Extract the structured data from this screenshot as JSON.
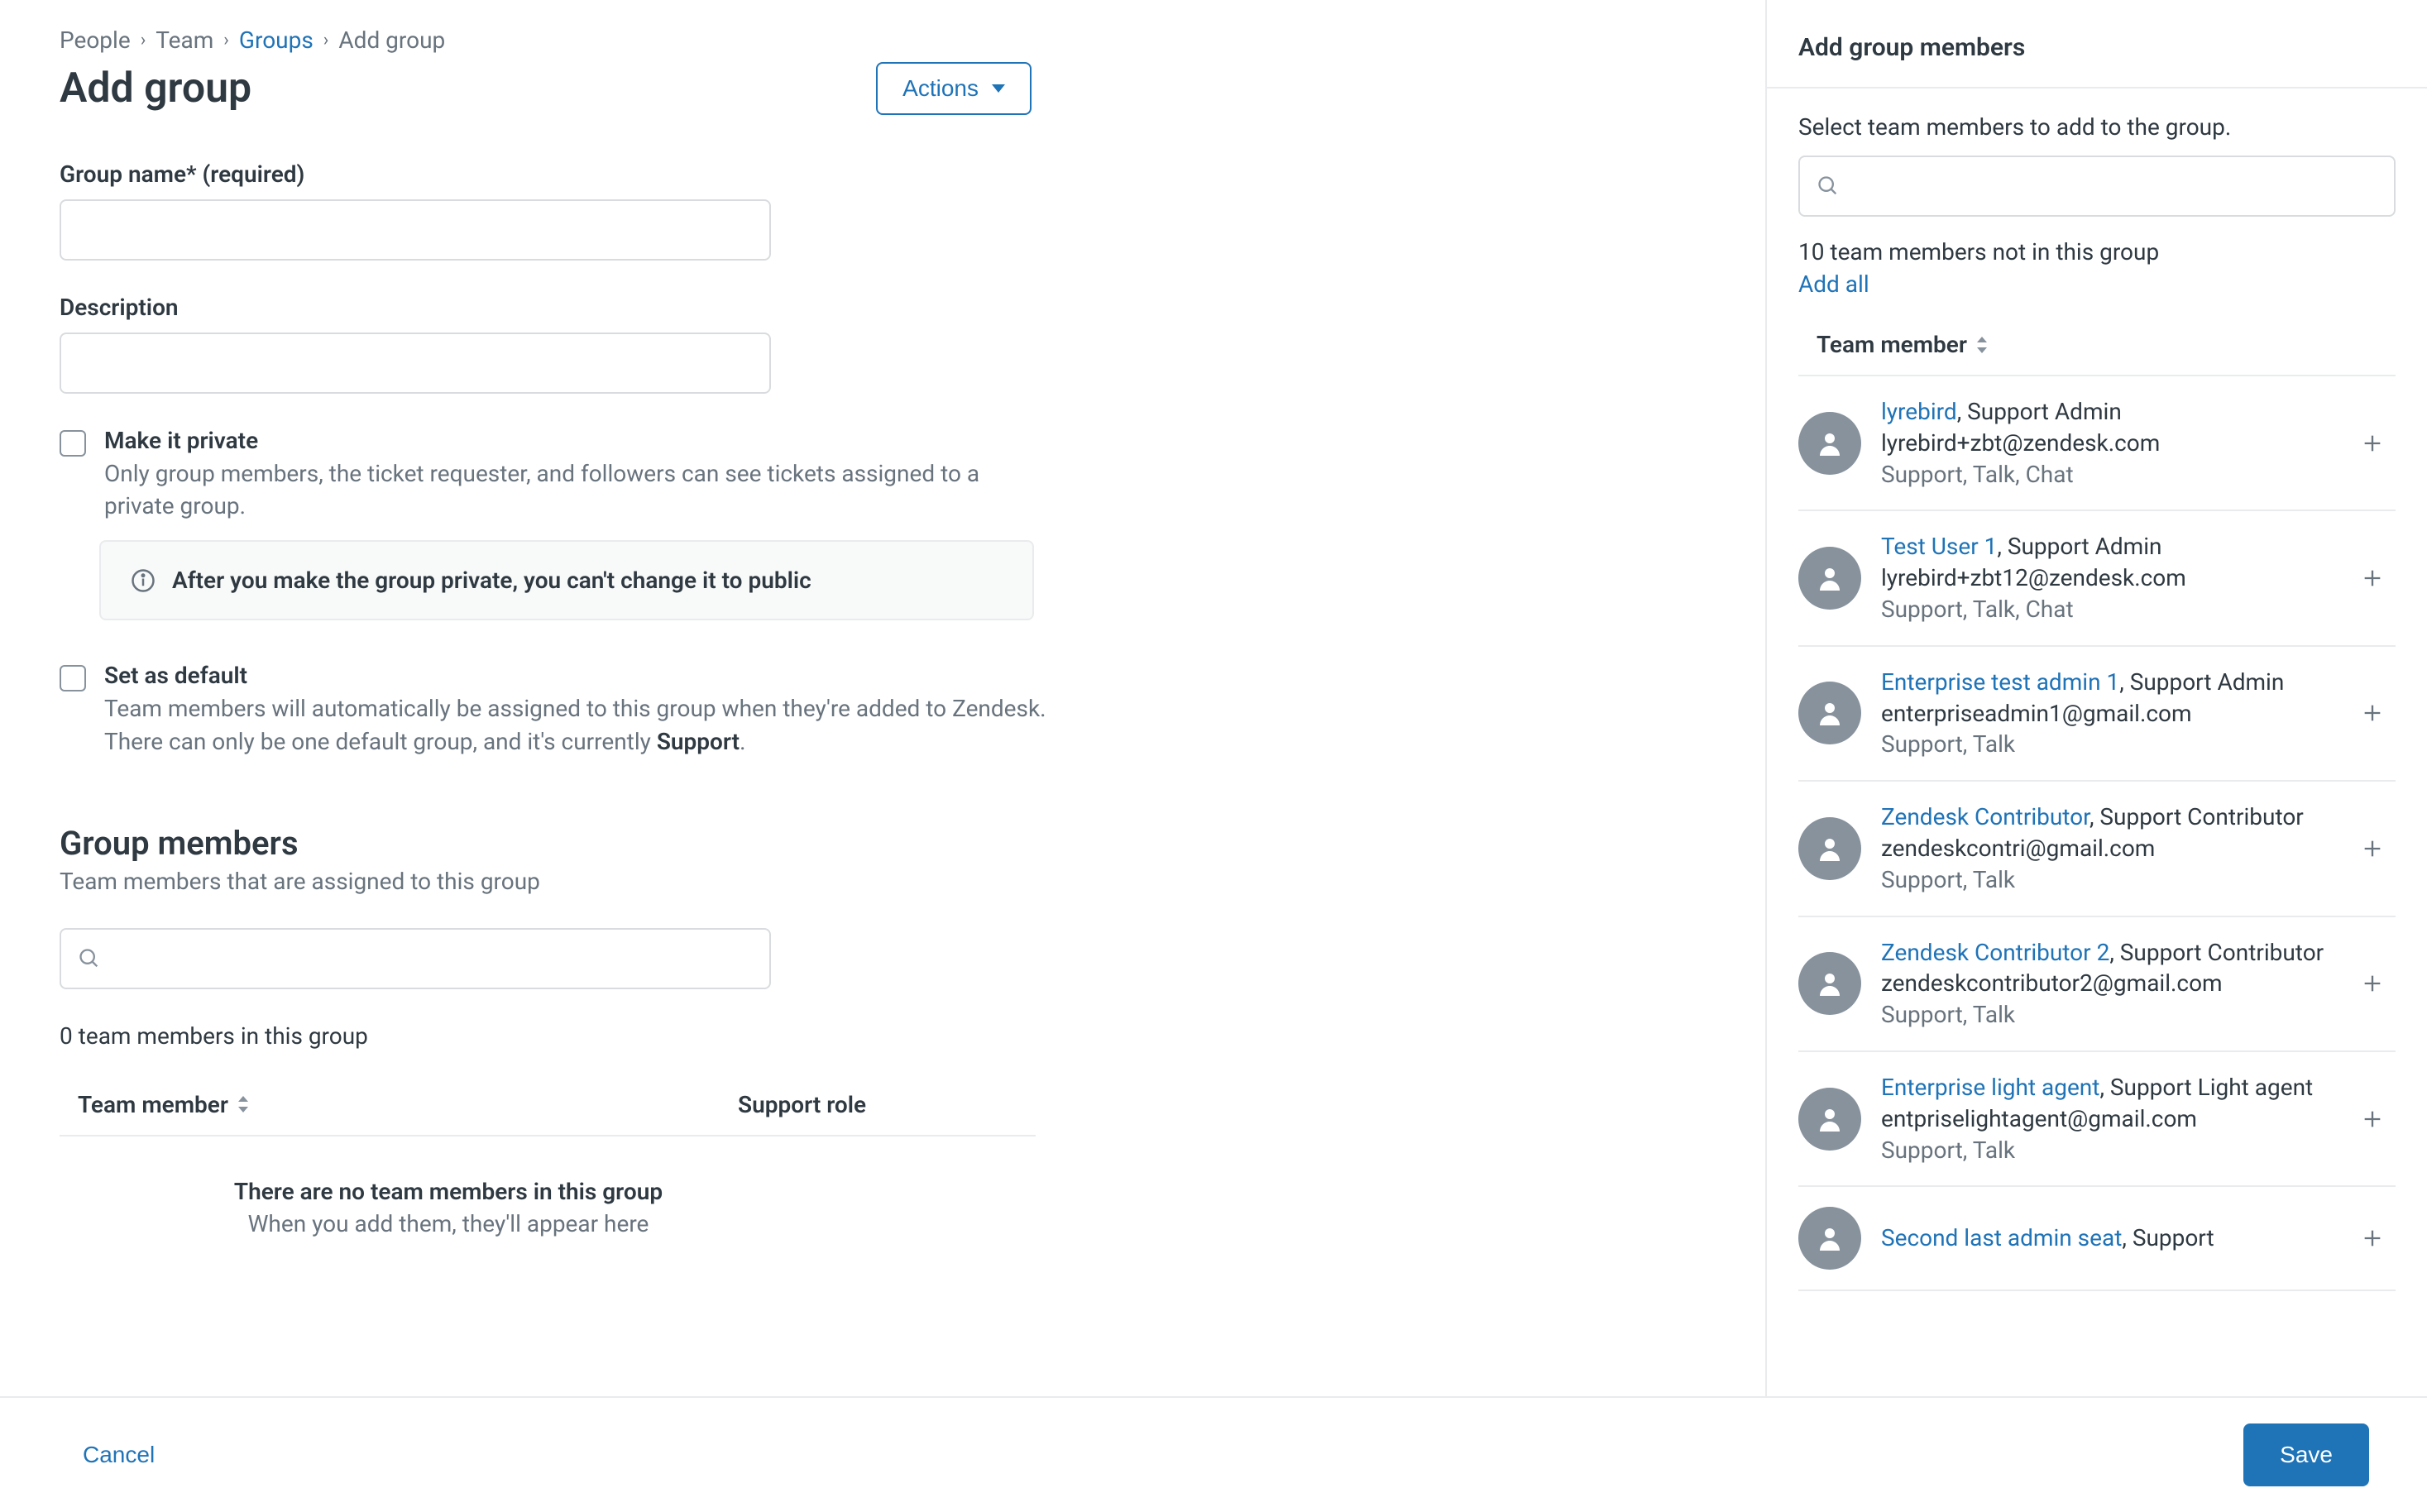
{
  "breadcrumb": {
    "people": "People",
    "team": "Team",
    "groups": "Groups",
    "current": "Add group"
  },
  "page_title": "Add group",
  "actions_label": "Actions",
  "form": {
    "group_name_label": "Group name* (required)",
    "description_label": "Description",
    "private": {
      "title": "Make it private",
      "desc": "Only group members, the ticket requester, and followers can see tickets assigned to a private group.",
      "info": "After you make the group private, you can't change it to public"
    },
    "default": {
      "title": "Set as default",
      "desc_before": "Team members will automatically be assigned to this group when they're added to Zendesk. There can only be one default group, and it's currently ",
      "desc_strong": "Support",
      "desc_after": "."
    }
  },
  "members_section": {
    "heading": "Group members",
    "sub": "Team members that are assigned to this group",
    "count_line": "0 team members in this group",
    "col_member": "Team member",
    "col_role": "Support role",
    "empty_line1": "There are no team members in this group",
    "empty_line2": "When you add them, they'll appear here"
  },
  "side": {
    "heading": "Add group members",
    "hint": "Select team members to add to the group.",
    "count_line": "10 team members not in this group",
    "add_all": "Add all",
    "col_member": "Team member",
    "members": [
      {
        "name": "lyrebird",
        "role": "Support Admin",
        "email": "lyrebird+zbt@zendesk.com",
        "products": "Support, Talk, Chat"
      },
      {
        "name": "Test User 1",
        "role": "Support Admin",
        "email": "lyrebird+zbt12@zendesk.com",
        "products": "Support, Talk, Chat"
      },
      {
        "name": "Enterprise test admin 1",
        "role": "Support Admin",
        "email": "enterpriseadmin1@gmail.com",
        "products": "Support, Talk"
      },
      {
        "name": "Zendesk Contributor",
        "role": "Support Contributor",
        "email": "zendeskcontri@gmail.com",
        "products": "Support, Talk"
      },
      {
        "name": "Zendesk Contributor 2",
        "role": "Support Contributor",
        "email": "zendeskcontributor2@gmail.com",
        "products": "Support, Talk"
      },
      {
        "name": "Enterprise light agent",
        "role": "Support Light agent",
        "email": "entpriselightagent@gmail.com",
        "products": "Support, Talk"
      },
      {
        "name": "Second last admin seat",
        "role": "Support",
        "email": "",
        "products": ""
      }
    ]
  },
  "footer": {
    "cancel": "Cancel",
    "save": "Save"
  }
}
